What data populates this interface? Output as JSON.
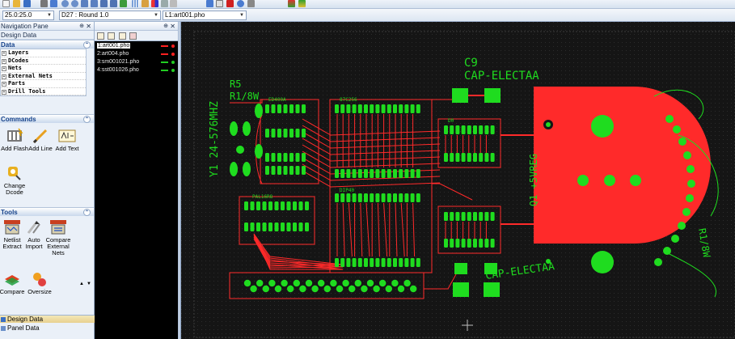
{
  "toolbar": {
    "aperture_value": "25.0:25.0",
    "dcode_value": "D27 : Round 1.0",
    "layer_value": "L1:art001.pho"
  },
  "nav_pane": {
    "title": "Navigation Pane",
    "design_data_header": "Design Data",
    "data_section": {
      "title": "Data",
      "items": [
        {
          "label": "Layers"
        },
        {
          "label": "DCodes"
        },
        {
          "label": "Nets"
        },
        {
          "label": "External Nets"
        },
        {
          "label": "Parts"
        },
        {
          "label": "Drill Tools"
        }
      ]
    },
    "commands_section": {
      "title": "Commands",
      "items": [
        {
          "label": "Add Flash"
        },
        {
          "label": "Add Line"
        },
        {
          "label": "Add Text"
        },
        {
          "label": "Change Dcode"
        }
      ]
    },
    "tools_section": {
      "title": "Tools",
      "items": [
        {
          "label": "Netlist Extract"
        },
        {
          "label": "Auto Import"
        },
        {
          "label": "Compare External Nets"
        },
        {
          "label": "Compare"
        },
        {
          "label": "Oversize"
        }
      ]
    },
    "bottom_items": [
      {
        "label": "Design Data"
      },
      {
        "label": "Panel Data"
      }
    ]
  },
  "layers": {
    "items": [
      {
        "name": "1:art001.pho",
        "color": "#ff2020",
        "active": true
      },
      {
        "name": "2:art004.pho",
        "color": "#ff2020",
        "active": false
      },
      {
        "name": "3:sm001021.pho",
        "color": "#22cc22",
        "active": false
      },
      {
        "name": "4:sst001026.pho",
        "color": "#22cc22",
        "active": false
      }
    ]
  },
  "pcb": {
    "colors": {
      "copper": "#ff2a2a",
      "mask": "#1fdc1f",
      "background": "#151515",
      "grid": "#2a2a2a"
    },
    "labels": {
      "c9_ref": "C9",
      "c9_value": "CAP-ELECTAA",
      "r5_ref": "R5",
      "r5_value": "R1/8W",
      "crystal": "Y1 24-576MHZ",
      "cap_electaa_lower": "CAP-ELECTAA",
      "vreg": "Q1 +5VREG",
      "r8w": "R1/8W",
      "chip_1": "ED400A",
      "chip_2": "87C256",
      "chip_3": "PAL16R8",
      "chip_4": "D0",
      "chip_5": "DIP40"
    }
  }
}
